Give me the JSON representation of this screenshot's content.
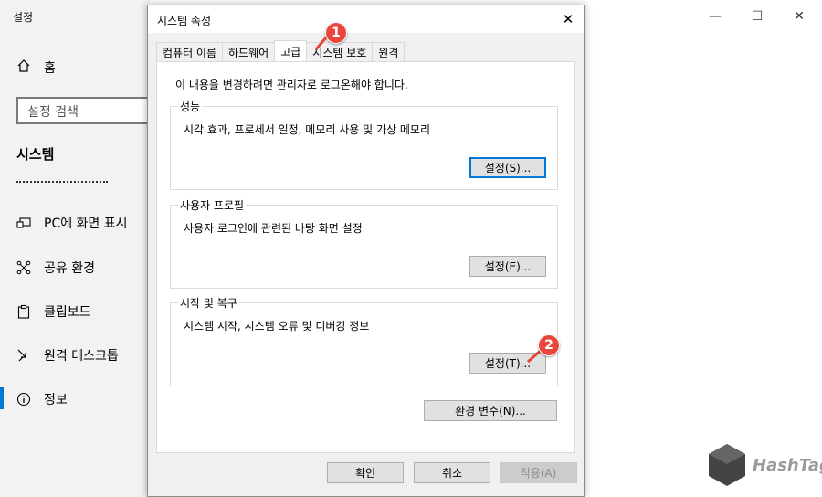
{
  "settings": {
    "app_title": "설정",
    "home_label": "홈",
    "search_placeholder": "설정 검색",
    "section_title": "시스템",
    "nav_items": [
      {
        "label": "PC에 화면 표시",
        "icon": "project-icon"
      },
      {
        "label": "공유 환경",
        "icon": "share-icon"
      },
      {
        "label": "클립보드",
        "icon": "clipboard-icon"
      },
      {
        "label": "원격 데스크톱",
        "icon": "remote-desktop-icon"
      },
      {
        "label": "정보",
        "icon": "info-icon"
      }
    ],
    "accent_color": "#0078d4"
  },
  "window_controls": {
    "minimize": "—",
    "maximize": "☐",
    "close": "✕"
  },
  "dialog": {
    "title": "시스템 속성",
    "close_glyph": "✕",
    "tabs": [
      "컴퓨터 이름",
      "하드웨어",
      "고급",
      "시스템 보호",
      "원격"
    ],
    "active_tab": "고급",
    "admin_note": "이 내용을 변경하려면 관리자로 로그온해야 합니다.",
    "groups": {
      "performance": {
        "label": "성능",
        "description": "시각 효과, 프로세서 일정, 메모리 사용 및 가상 메모리",
        "button": "설정(S)..."
      },
      "user_profiles": {
        "label": "사용자 프로필",
        "description": "사용자 로그인에 관련된 바탕 화면 설정",
        "button": "설정(E)..."
      },
      "startup_recovery": {
        "label": "시작 및 복구",
        "description": "시스템 시작, 시스템 오류 및 디버깅 정보",
        "button": "설정(T)..."
      }
    },
    "env_button": "환경 변수(N)...",
    "ok": "확인",
    "cancel": "취소",
    "apply": "적용(A)"
  },
  "annotations": {
    "step1": "1",
    "step2": "2",
    "color": "#e8453c"
  },
  "watermark": {
    "text": "HashTag"
  }
}
